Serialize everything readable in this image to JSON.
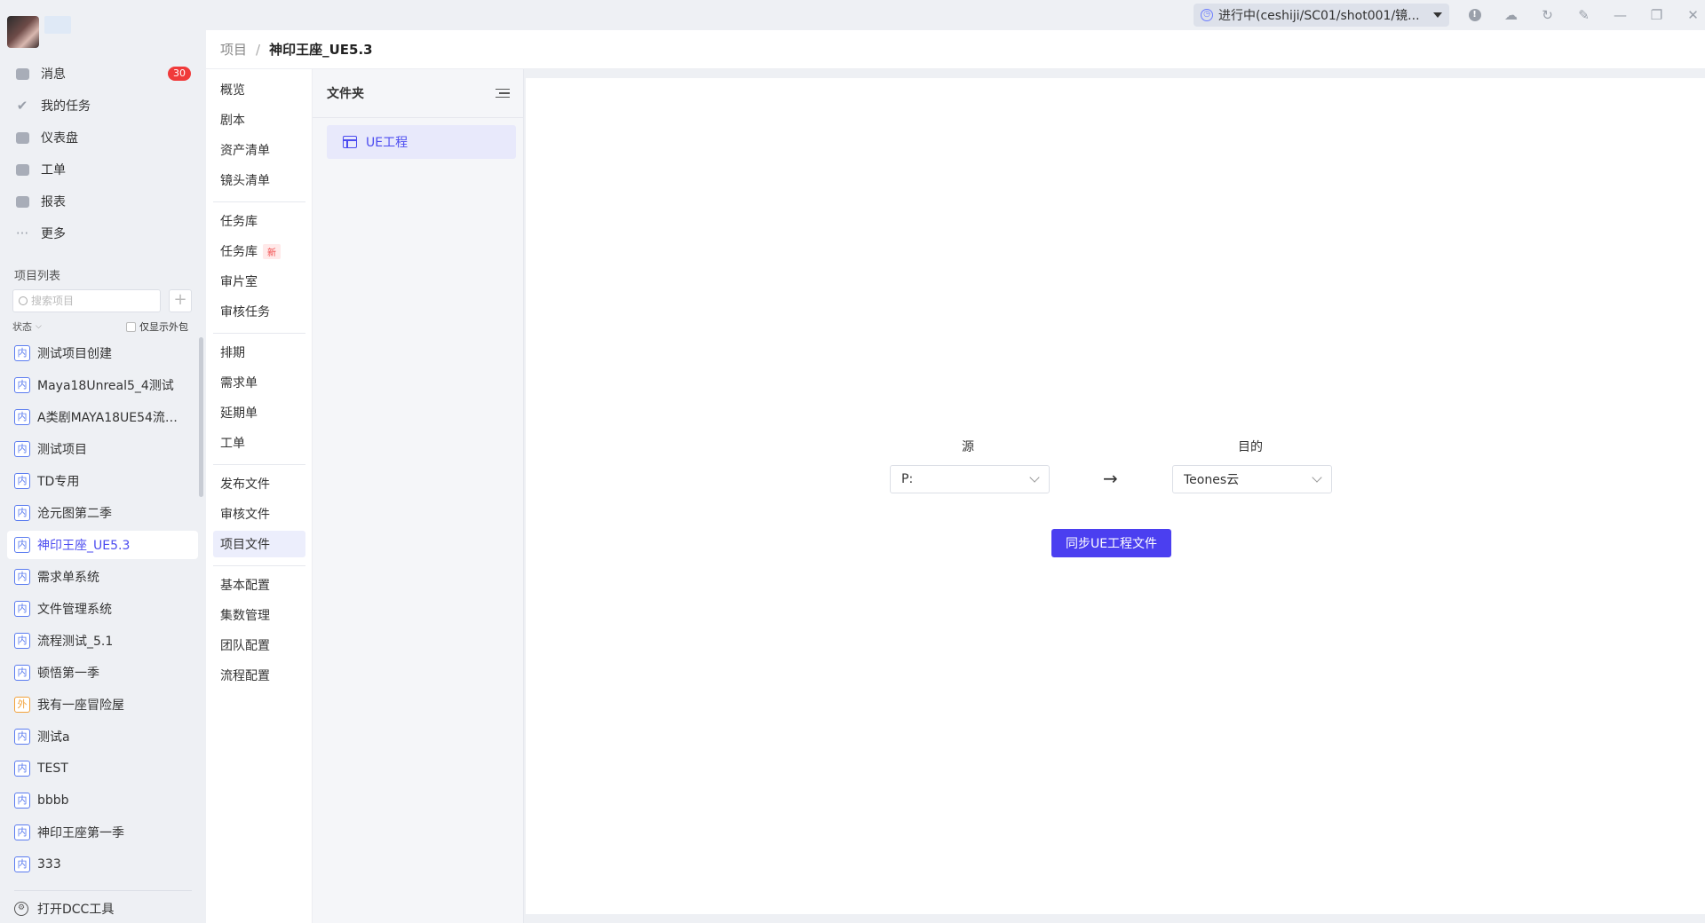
{
  "topbar": {
    "task_status": "进行中(ceshiji/SC01/shot001/镜..."
  },
  "nav": {
    "items": [
      {
        "label": "消息",
        "icon": "message-icon",
        "badge": "30"
      },
      {
        "label": "我的任务",
        "icon": "check-icon"
      },
      {
        "label": "仪表盘",
        "icon": "dashboard-icon"
      },
      {
        "label": "工单",
        "icon": "ticket-icon"
      },
      {
        "label": "报表",
        "icon": "report-icon"
      },
      {
        "label": "更多",
        "icon": "more-icon"
      }
    ]
  },
  "projects": {
    "title": "项目列表",
    "search_placeholder": "搜索项目",
    "status_label": "状态",
    "outsource_label": "仅显示外包",
    "items": [
      {
        "tag": "内",
        "name": "测试项目创建"
      },
      {
        "tag": "内",
        "name": "Maya18Unreal5_4测试"
      },
      {
        "tag": "内",
        "name": "A类剧MAYA18UE54流程..."
      },
      {
        "tag": "内",
        "name": "测试项目"
      },
      {
        "tag": "内",
        "name": "TD专用"
      },
      {
        "tag": "内",
        "name": "沧元图第二季"
      },
      {
        "tag": "内",
        "name": "神印王座_UE5.3",
        "active": true
      },
      {
        "tag": "内",
        "name": "需求单系统"
      },
      {
        "tag": "内",
        "name": "文件管理系统"
      },
      {
        "tag": "内",
        "name": "流程测试_5.1"
      },
      {
        "tag": "内",
        "name": "顿悟第一季"
      },
      {
        "tag": "外",
        "name": "我有一座冒险屋"
      },
      {
        "tag": "内",
        "name": "测试a"
      },
      {
        "tag": "内",
        "name": "TEST"
      },
      {
        "tag": "内",
        "name": "bbbb"
      },
      {
        "tag": "内",
        "name": "神印王座第一季"
      },
      {
        "tag": "内",
        "name": "333"
      }
    ],
    "dcc_label": "打开DCC工具"
  },
  "header": {
    "crumb": "项目",
    "separator": "/",
    "current": "神印王座_UE5.3"
  },
  "subnav": {
    "groups": [
      [
        "概览",
        "剧本",
        "资产清单",
        "镜头清单"
      ],
      [
        "任务库",
        "任务库",
        "审片室",
        "审核任务"
      ],
      [
        "排期",
        "需求单",
        "延期单",
        "工单"
      ],
      [
        "发布文件",
        "审核文件",
        "项目文件"
      ],
      [
        "基本配置",
        "集数管理",
        "团队配置",
        "流程配置"
      ]
    ],
    "new_tag": "新",
    "active": "项目文件"
  },
  "folders": {
    "title": "文件夹",
    "items": [
      "UE工程"
    ]
  },
  "sync": {
    "source_label": "源",
    "target_label": "目的",
    "source_value": "P:",
    "target_value": "Teones云",
    "button": "同步UE工程文件"
  }
}
